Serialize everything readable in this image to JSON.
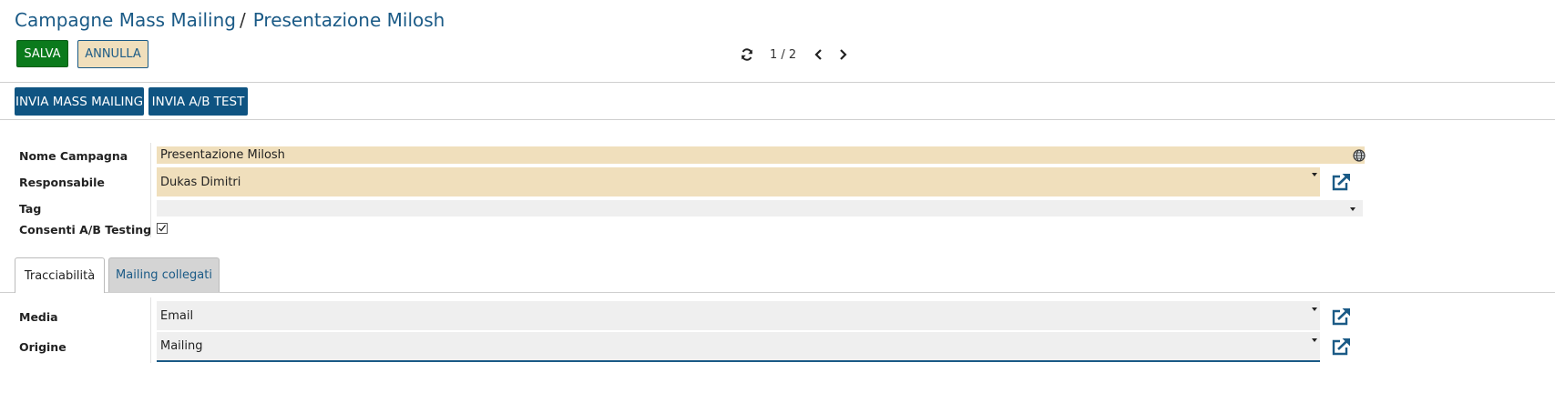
{
  "breadcrumb": {
    "parent": "Campagne Mass Mailing",
    "separator": "/",
    "current": "Presentazione Milosh"
  },
  "toolbar": {
    "save_label": "SALVA",
    "cancel_label": "ANNULLA"
  },
  "pager": {
    "counter": "1 / 2",
    "refresh_icon": "refresh-icon",
    "prev_icon": "chevron-left-icon",
    "next_icon": "chevron-right-icon"
  },
  "actions": {
    "send_mass_mailing": "INVIA MASS MAILING",
    "send_ab_test": "INVIA A/B TEST"
  },
  "form": {
    "campaign_name": {
      "label": "Nome Campagna",
      "value": "Presentazione Milosh"
    },
    "responsible": {
      "label": "Responsabile",
      "value": "Dukas Dimitri"
    },
    "tag": {
      "label": "Tag",
      "value": ""
    },
    "ab_testing": {
      "label": "Consenti A/B Testing",
      "checked": true
    }
  },
  "tabs": [
    {
      "label": "Tracciabilità",
      "active": true
    },
    {
      "label": "Mailing collegati",
      "active": false
    }
  ],
  "tracking": {
    "media": {
      "label": "Media",
      "value": "Email"
    },
    "source": {
      "label": "Origine",
      "value": "Mailing"
    }
  },
  "colors": {
    "accent": "#1a5a86",
    "save": "#0b7a1c",
    "action": "#0f5482",
    "required_field": "#f0dfbc",
    "field": "#efefef"
  }
}
